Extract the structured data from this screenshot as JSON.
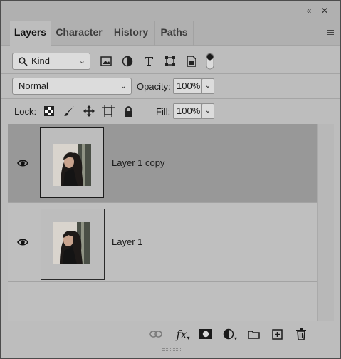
{
  "window_controls": {
    "collapse_glyph": "«",
    "close_glyph": "✕"
  },
  "tabs": [
    {
      "label": "Layers",
      "active": true
    },
    {
      "label": "Character",
      "active": false
    },
    {
      "label": "History",
      "active": false
    },
    {
      "label": "Paths",
      "active": false
    }
  ],
  "filter": {
    "kind_label": "Kind",
    "icons": [
      "image-filter-icon",
      "adjustment-filter-icon",
      "type-filter-icon",
      "shape-filter-icon",
      "smart-object-filter-icon",
      "filter-toggle-switch"
    ]
  },
  "blend": {
    "mode": "Normal",
    "opacity_label": "Opacity:",
    "opacity_value": "100%"
  },
  "lock": {
    "label": "Lock:",
    "fill_label": "Fill:",
    "fill_value": "100%"
  },
  "layers": [
    {
      "name": "Layer 1 copy",
      "visible": true,
      "selected": true
    },
    {
      "name": "Layer 1",
      "visible": true,
      "selected": false
    }
  ],
  "bottom_toolbar": {
    "fx_label": "fx",
    "icons": [
      "link-layers-icon",
      "layer-style-icon",
      "add-mask-icon",
      "adjustment-layer-icon",
      "new-group-icon",
      "new-layer-icon",
      "delete-layer-icon"
    ]
  },
  "colors": {
    "panel_bg": "#bdbdbd",
    "selected_layer": "#989898",
    "tab_bar": "#b0b0b0"
  }
}
